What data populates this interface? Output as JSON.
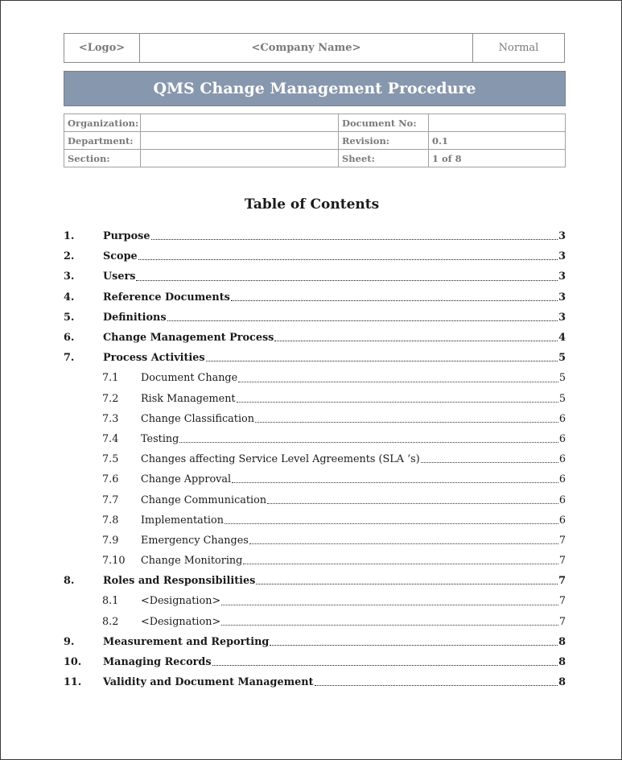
{
  "header": {
    "logo": "<Logo>",
    "company": "<Company Name>",
    "classification": "Normal"
  },
  "title": "QMS Change Management Procedure",
  "colors": {
    "title_bar": "#8797ae",
    "header_text": "#7a7a7a"
  },
  "info": {
    "organization_label": "Organization:",
    "organization_value": "",
    "department_label": "Department:",
    "department_value": "",
    "section_label": "Section:",
    "section_value": "",
    "document_no_label": "Document No:",
    "document_no_value": "",
    "revision_label": "Revision:",
    "revision_value": "0.1",
    "sheet_label": "Sheet:",
    "sheet_value": "1 of 8"
  },
  "toc": {
    "title": "Table of Contents",
    "entries": [
      {
        "num": "1.",
        "text": "Purpose ",
        "page": "3",
        "level": 1
      },
      {
        "num": "2.",
        "text": "Scope ",
        "page": "3",
        "level": 1
      },
      {
        "num": "3.",
        "text": "Users",
        "page": "3",
        "level": 1
      },
      {
        "num": "4.",
        "text": "Reference Documents",
        "page": "3",
        "level": 1
      },
      {
        "num": "5.",
        "text": "Definitions",
        "page": "3",
        "level": 1
      },
      {
        "num": "6.",
        "text": "Change Management Process",
        "page": "4",
        "level": 1
      },
      {
        "num": "7.",
        "text": "Process Activities ",
        "page": "5",
        "level": 1
      },
      {
        "num": "7.1",
        "text": "Document Change ",
        "page": "5",
        "level": 2
      },
      {
        "num": "7.2",
        "text": "Risk Management",
        "page": "5",
        "level": 2
      },
      {
        "num": "7.3",
        "text": "Change Classification",
        "page": "6",
        "level": 2
      },
      {
        "num": "7.4",
        "text": "Testing",
        "page": "6",
        "level": 2
      },
      {
        "num": "7.5",
        "text": "Changes affecting Service Level Agreements (SLA ‘s)",
        "page": "6",
        "level": 2
      },
      {
        "num": "7.6",
        "text": "Change Approval",
        "page": "6",
        "level": 2
      },
      {
        "num": "7.7",
        "text": "Change Communication",
        "page": "6",
        "level": 2
      },
      {
        "num": "7.8",
        "text": "Implementation",
        "page": "6",
        "level": 2
      },
      {
        "num": "7.9",
        "text": "Emergency Changes ",
        "page": "7",
        "level": 2
      },
      {
        "num": "7.10",
        "text": "Change Monitoring ",
        "page": "7",
        "level": 2
      },
      {
        "num": "8.",
        "text": "Roles and Responsibilities",
        "page": "7",
        "level": 1
      },
      {
        "num": "8.1",
        "text": "<Designation>",
        "page": "7",
        "level": 2
      },
      {
        "num": "8.2",
        "text": "<Designation>",
        "page": "7",
        "level": 2
      },
      {
        "num": "9.",
        "text": "Measurement and Reporting ",
        "page": "8",
        "level": 1
      },
      {
        "num": "10.",
        "text": "Managing Records",
        "page": "8",
        "level": 1
      },
      {
        "num": "11.",
        "text": "Validity and Document Management",
        "page": "8",
        "level": 1
      }
    ]
  }
}
